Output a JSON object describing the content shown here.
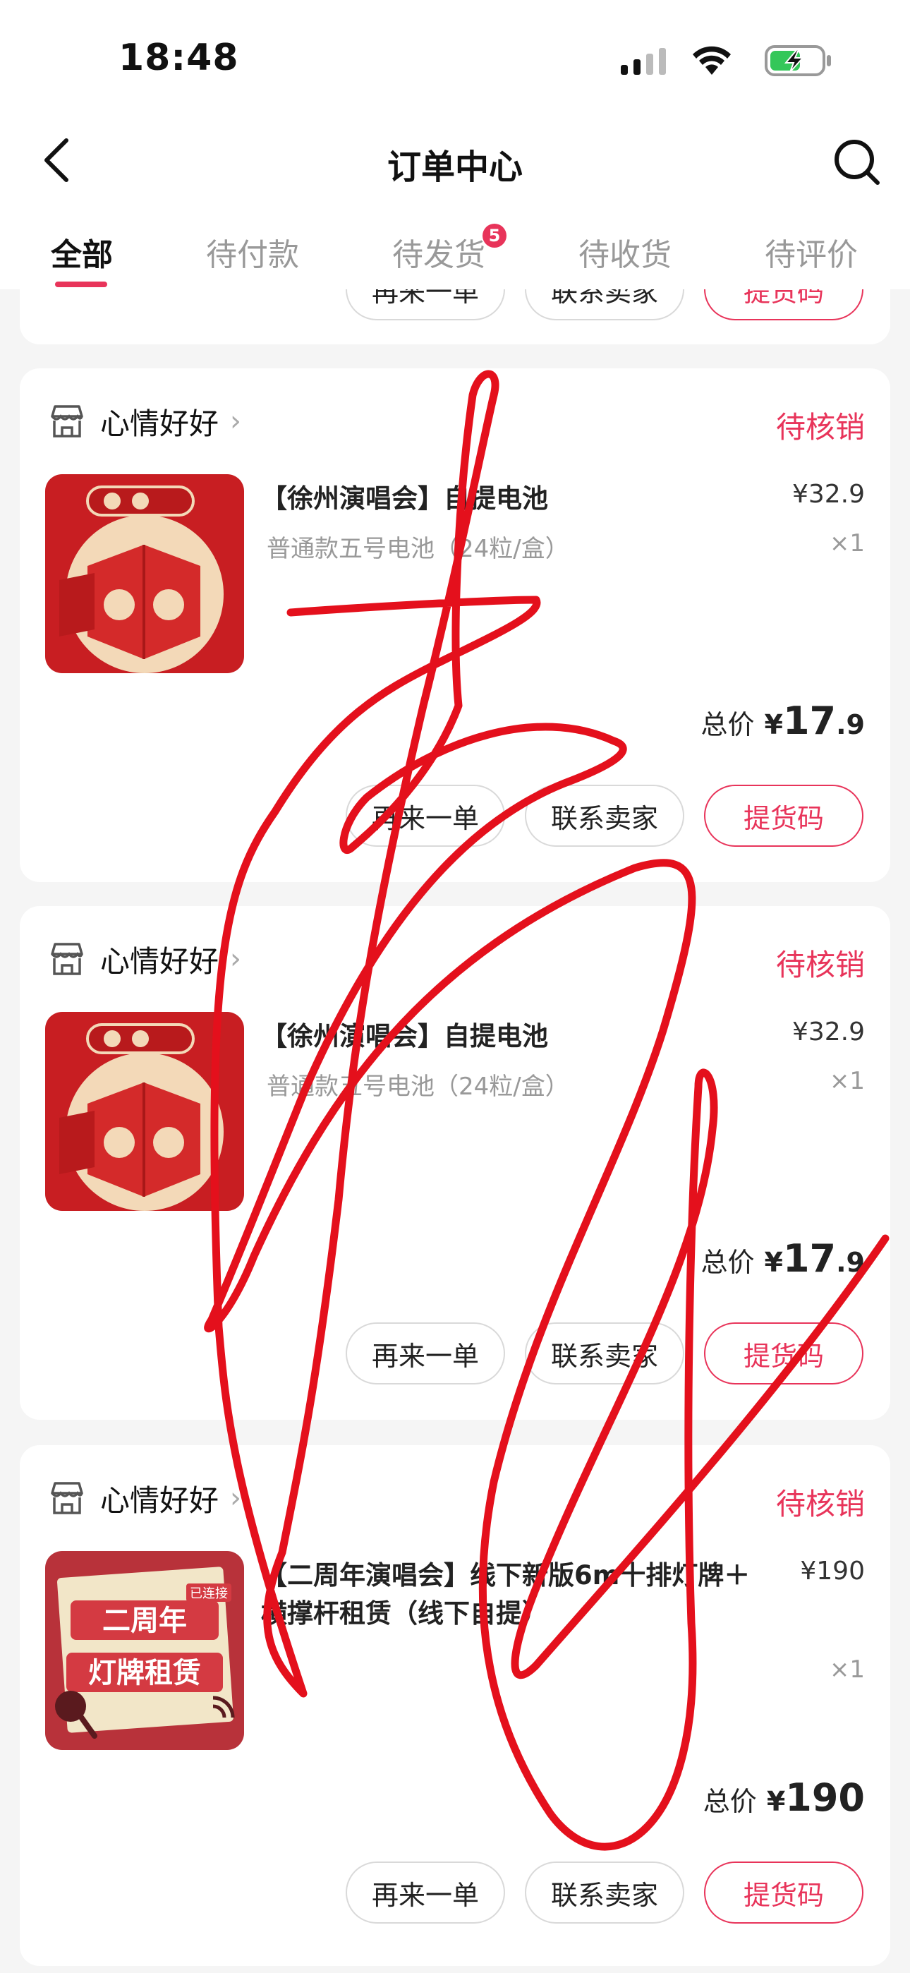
{
  "status_bar": {
    "time": "18:48"
  },
  "nav": {
    "title": "订单中心"
  },
  "tabs": [
    {
      "label": "全部"
    },
    {
      "label": "待付款"
    },
    {
      "label": "待发货",
      "badge": "5"
    },
    {
      "label": "待收货"
    },
    {
      "label": "待评价"
    }
  ],
  "prev_card": {
    "buttons": [
      "再来一单",
      "联系卖家",
      "提货码"
    ]
  },
  "orders": [
    {
      "shop": "心情好好",
      "status": "待核销",
      "title": "【徐州演唱会】自提电池",
      "variant": "普通款五号电池（24粒/盒）",
      "price": "¥32.9",
      "qty": "×1",
      "total_label": "总价",
      "total_symbol": "¥",
      "total_int": "17",
      "total_dec": ".9",
      "buttons": [
        "再来一单",
        "联系卖家",
        "提货码"
      ]
    },
    {
      "shop": "心情好好",
      "status": "待核销",
      "title": "【徐州演唱会】自提电池",
      "variant": "普通款五号电池（24粒/盒）",
      "price": "¥32.9",
      "qty": "×1",
      "total_label": "总价",
      "total_symbol": "¥",
      "total_int": "17",
      "total_dec": ".9",
      "buttons": [
        "再来一单",
        "联系卖家",
        "提货码"
      ]
    },
    {
      "shop": "心情好好",
      "status": "待核销",
      "title": "【二周年演唱会】线下新版6m十排灯牌＋横撑杆租赁（线下自提）",
      "variant": "",
      "price": "¥190",
      "qty": "×1",
      "total_label": "总价",
      "total_symbol": "¥",
      "total_int": "190",
      "total_dec": "",
      "buttons": [
        "再来一单",
        "联系卖家",
        "提货码"
      ],
      "thumb_text": {
        "line1": "二周年",
        "line2": "灯牌租赁",
        "tag": "已连接"
      }
    }
  ],
  "colors": {
    "accent": "#e8345a",
    "signature": "#e4101c"
  }
}
